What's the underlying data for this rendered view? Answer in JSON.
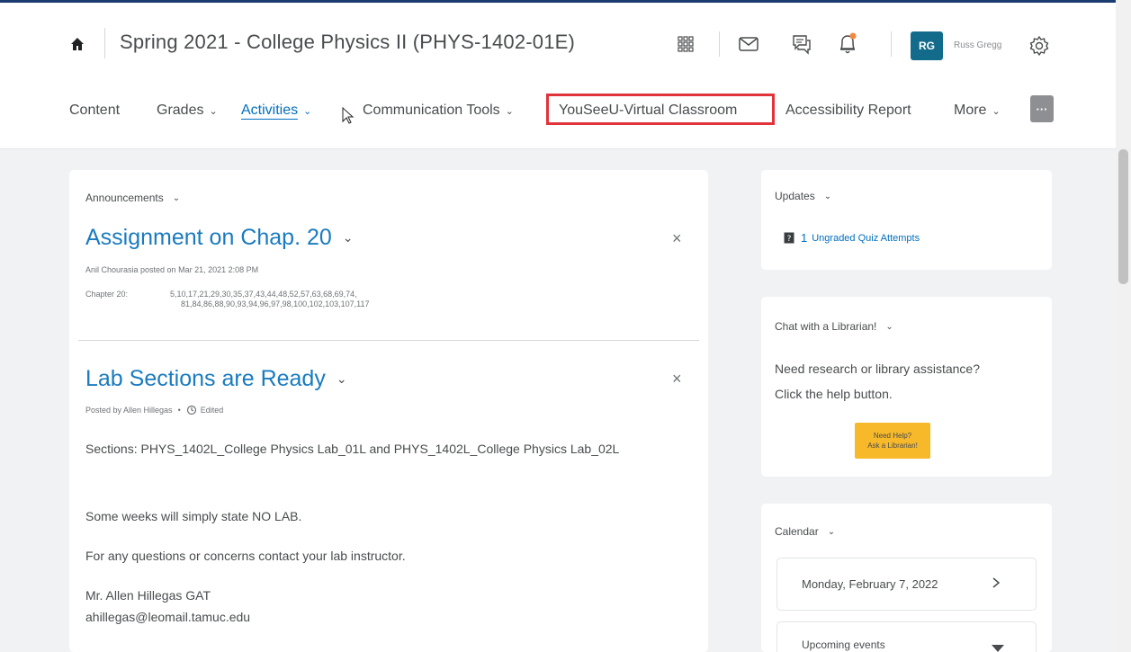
{
  "header": {
    "course_title": "Spring 2021 - College Physics II (PHYS-1402-01E)",
    "avatar_initials": "RG",
    "username": "Russ Gregg",
    "avatar_color": "#136b8b",
    "notification_dot_color": "#f4883f"
  },
  "nav": {
    "items": [
      {
        "label": "Content"
      },
      {
        "label": "Grades"
      },
      {
        "label": "Activities"
      },
      {
        "label": "Communication Tools"
      },
      {
        "label": "YouSeeU-Virtual Classroom"
      },
      {
        "label": "Accessibility Report"
      },
      {
        "label": "More"
      }
    ],
    "more_button_label": "···",
    "highlight_color": "#e0333a"
  },
  "announcements": {
    "widget_title": "Announcements",
    "items": [
      {
        "title": "Assignment on Chap. 20",
        "meta": "Anil Chourasia posted on Mar 21, 2021 2:08 PM",
        "chapter_label": "Chapter 20:",
        "problems_line1": "5,10,17,21,29,30,35,37,43,44,48,52,57,63,68,69,74,",
        "problems_line2": "81,84,86,88,90,93,94,96,97,98,100,102,103,107,117"
      },
      {
        "title": "Lab Sections are Ready",
        "meta": "Posted by Allen Hillegas",
        "edited_label": "Edited",
        "paragraph1": "Sections: PHYS_1402L_College Physics Lab_01L and PHYS_1402L_College Physics Lab_02L",
        "paragraph2": "Some weeks will simply state NO LAB.",
        "paragraph3": "For any questions or concerns contact your lab instructor.",
        "signature_name": "Mr. Allen Hillegas GAT",
        "signature_email": "ahillegas@leomail.tamuc.edu"
      }
    ]
  },
  "updates": {
    "widget_title": "Updates",
    "count": "1",
    "link_text": "Ungraded Quiz Attempts"
  },
  "librarian": {
    "widget_title": "Chat with a Librarian!",
    "text_line1": "Need research or library assistance?",
    "text_line2": "Click the help button.",
    "button_line1": "Need Help?",
    "button_line2": "Ask a Librarian!",
    "button_color": "#f7b92a"
  },
  "calendar": {
    "widget_title": "Calendar",
    "date_label": "Monday, February 7, 2022",
    "upcoming_label": "Upcoming events"
  }
}
